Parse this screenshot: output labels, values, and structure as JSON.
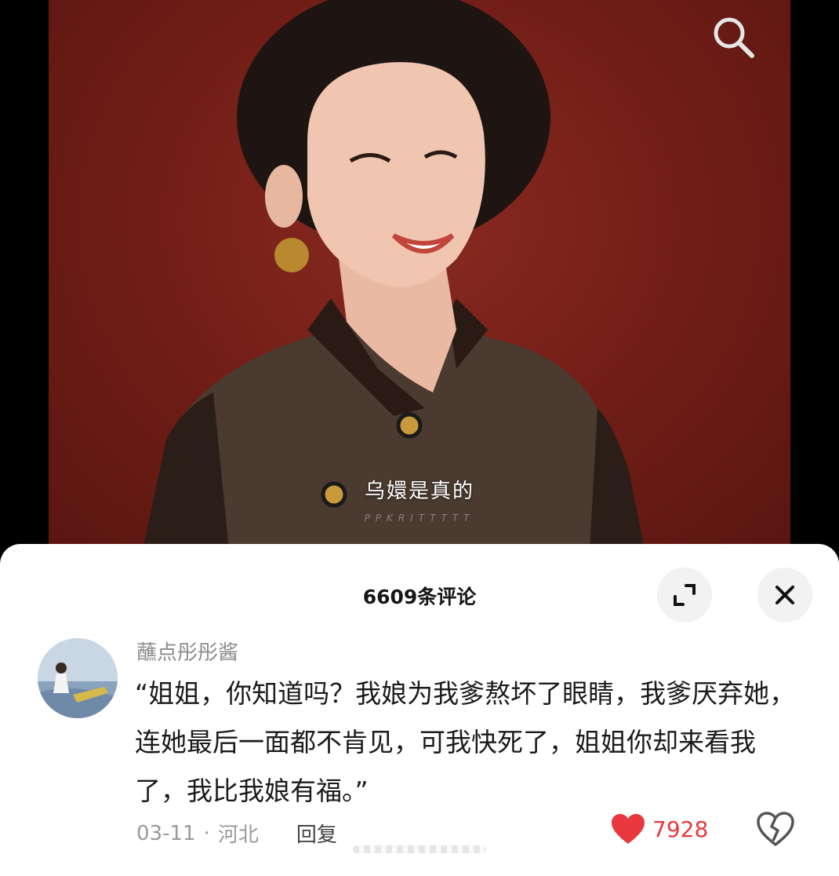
{
  "video": {
    "subtitle": "乌嬛是真的",
    "watermark": "PPKRITTTTT"
  },
  "comments_sheet": {
    "title": "6609条评论"
  },
  "comment": {
    "username": "蘸点彤彤酱",
    "text": "“姐姐，你知道吗？我娘为我爹熬坏了眼睛，我爹厌弃她，连她最后一面都不肯见，可我快死了，姐姐你却来看我了，我比我娘有福。”",
    "date": "03-11",
    "separator": "·",
    "location": "河北",
    "reply_label": "回复",
    "like_count": "7928"
  },
  "icons": {
    "search": "search-icon",
    "expand": "expand-icon",
    "close": "close-icon",
    "like": "heart-icon",
    "dislike": "broken-heart-icon"
  },
  "colors": {
    "accent_like": "#e8383d",
    "video_background": "#6f1d16"
  }
}
